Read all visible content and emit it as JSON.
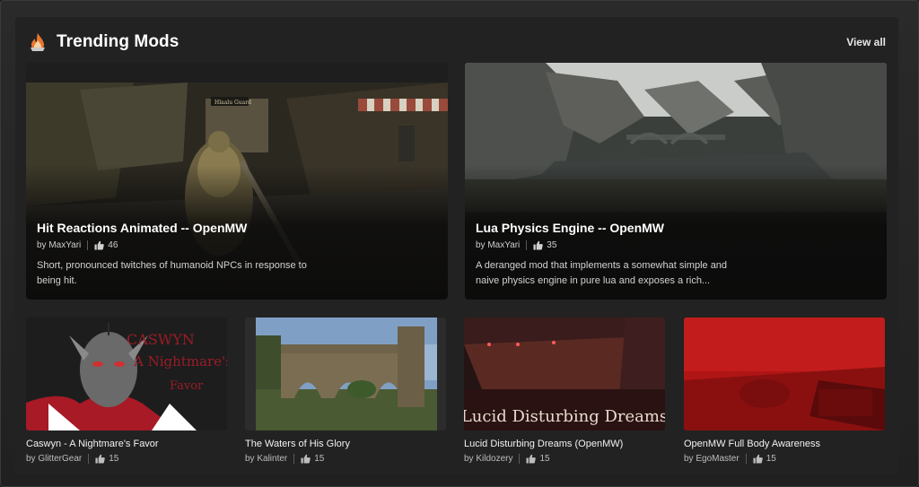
{
  "header": {
    "title": "Trending Mods",
    "view_all": "View all",
    "logo_icon": "flame-icon"
  },
  "featured": [
    {
      "title": "Hit Reactions Animated -- OpenMW",
      "author": "by MaxYari",
      "likes": "46",
      "description": "Short, pronounced twitches of humanoid NPCs in response to being hit.",
      "image": "armored-guard-scene"
    },
    {
      "title": "Lua Physics Engine -- OpenMW",
      "author": "by MaxYari",
      "likes": "35",
      "description": "A deranged mod that implements a somewhat simple and naive physics engine in pure lua and exposes a rich...",
      "image": "rocky-canyon-bridge-scene"
    }
  ],
  "cards": [
    {
      "title": "Caswyn - A Nightmare's Favor",
      "author": "by GlitterGear",
      "likes": "15",
      "image_text_1": "CASWYN",
      "image_text_2": "A Nightmare's",
      "image_text_3": "Favor"
    },
    {
      "title": "The Waters of His Glory",
      "author": "by Kalinter",
      "likes": "15",
      "image": "stone-aqueduct-scene"
    },
    {
      "title": "Lucid Disturbing Dreams (OpenMW)",
      "author": "by Kildozery",
      "likes": "15",
      "image_text": "Lucid Disturbing Dreams"
    },
    {
      "title": "OpenMW Full Body Awareness",
      "author": "by EgoMaster",
      "likes": "15",
      "image": "red-first-person-scene"
    }
  ],
  "colors": {
    "background": "#222222",
    "accent_orange": "#e8772e",
    "caswyn_red": "#b01c28",
    "full_body_red": "#b51515"
  },
  "icons": {
    "like": "thumbs-up-icon"
  }
}
